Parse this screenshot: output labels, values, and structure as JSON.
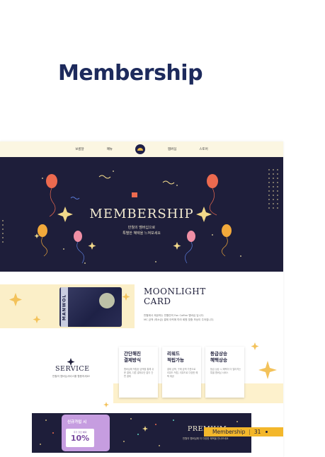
{
  "header": {
    "title": "Membership"
  },
  "nav": {
    "items": [
      "보름달",
      "매뉴",
      "멤버십",
      "스토어"
    ]
  },
  "hero": {
    "title": "MEMBERSHIP",
    "subtitle_line1": "만월의 멤버십으로",
    "subtitle_line2": "특별한 혜택을 느껴보세요"
  },
  "card_section": {
    "card_side_text": "MANWOL",
    "title_line1": "MOONLIGHT",
    "title_line2": "CARD",
    "desc_line1": "만월에서 제공하는 만월만의 Fan Coffee 멤버십 입니다.",
    "desc_line2": "MC 금액 (최소금) 결제 이력에 따라 회원 맞춤 보상이 주어집니다."
  },
  "service": {
    "title": "SERVICE",
    "subtitle": "만월의 멤버십서비스를 활용하세요!",
    "cards": [
      {
        "title_1": "간단해진",
        "title_2": "결제방식",
        "desc": "멤버십에 적립된 금액을 통해 쉬운 결제, 다른 결제수단 없이 간편 결제"
      },
      {
        "title_1": "리워드",
        "title_2": "적립가능",
        "desc": "결제 금액, 구매 금액 기준으로 리워드 적립, 리워드로 다양한 혜택 제공"
      },
      {
        "title_1": "등급상승",
        "title_2": "혜택상승",
        "desc": "등급 상승 시 혜택이 더 많아지는 특별 멤버십 서비스"
      }
    ]
  },
  "premium": {
    "badge_title": "신규가입 시",
    "badge_small": "추가 할인 혜택",
    "badge_percent": "10%",
    "title": "PREMIUM",
    "subtitle": "만월의 멤버십에 더 다양한 혜택을 만나보세요"
  },
  "footer": {
    "label": "Membership",
    "separator": "|",
    "page": "31"
  },
  "colors": {
    "navy": "#1e1e3a",
    "gold": "#f3b72b",
    "cream": "#fbefc8",
    "title_navy": "#1d2a5c"
  }
}
